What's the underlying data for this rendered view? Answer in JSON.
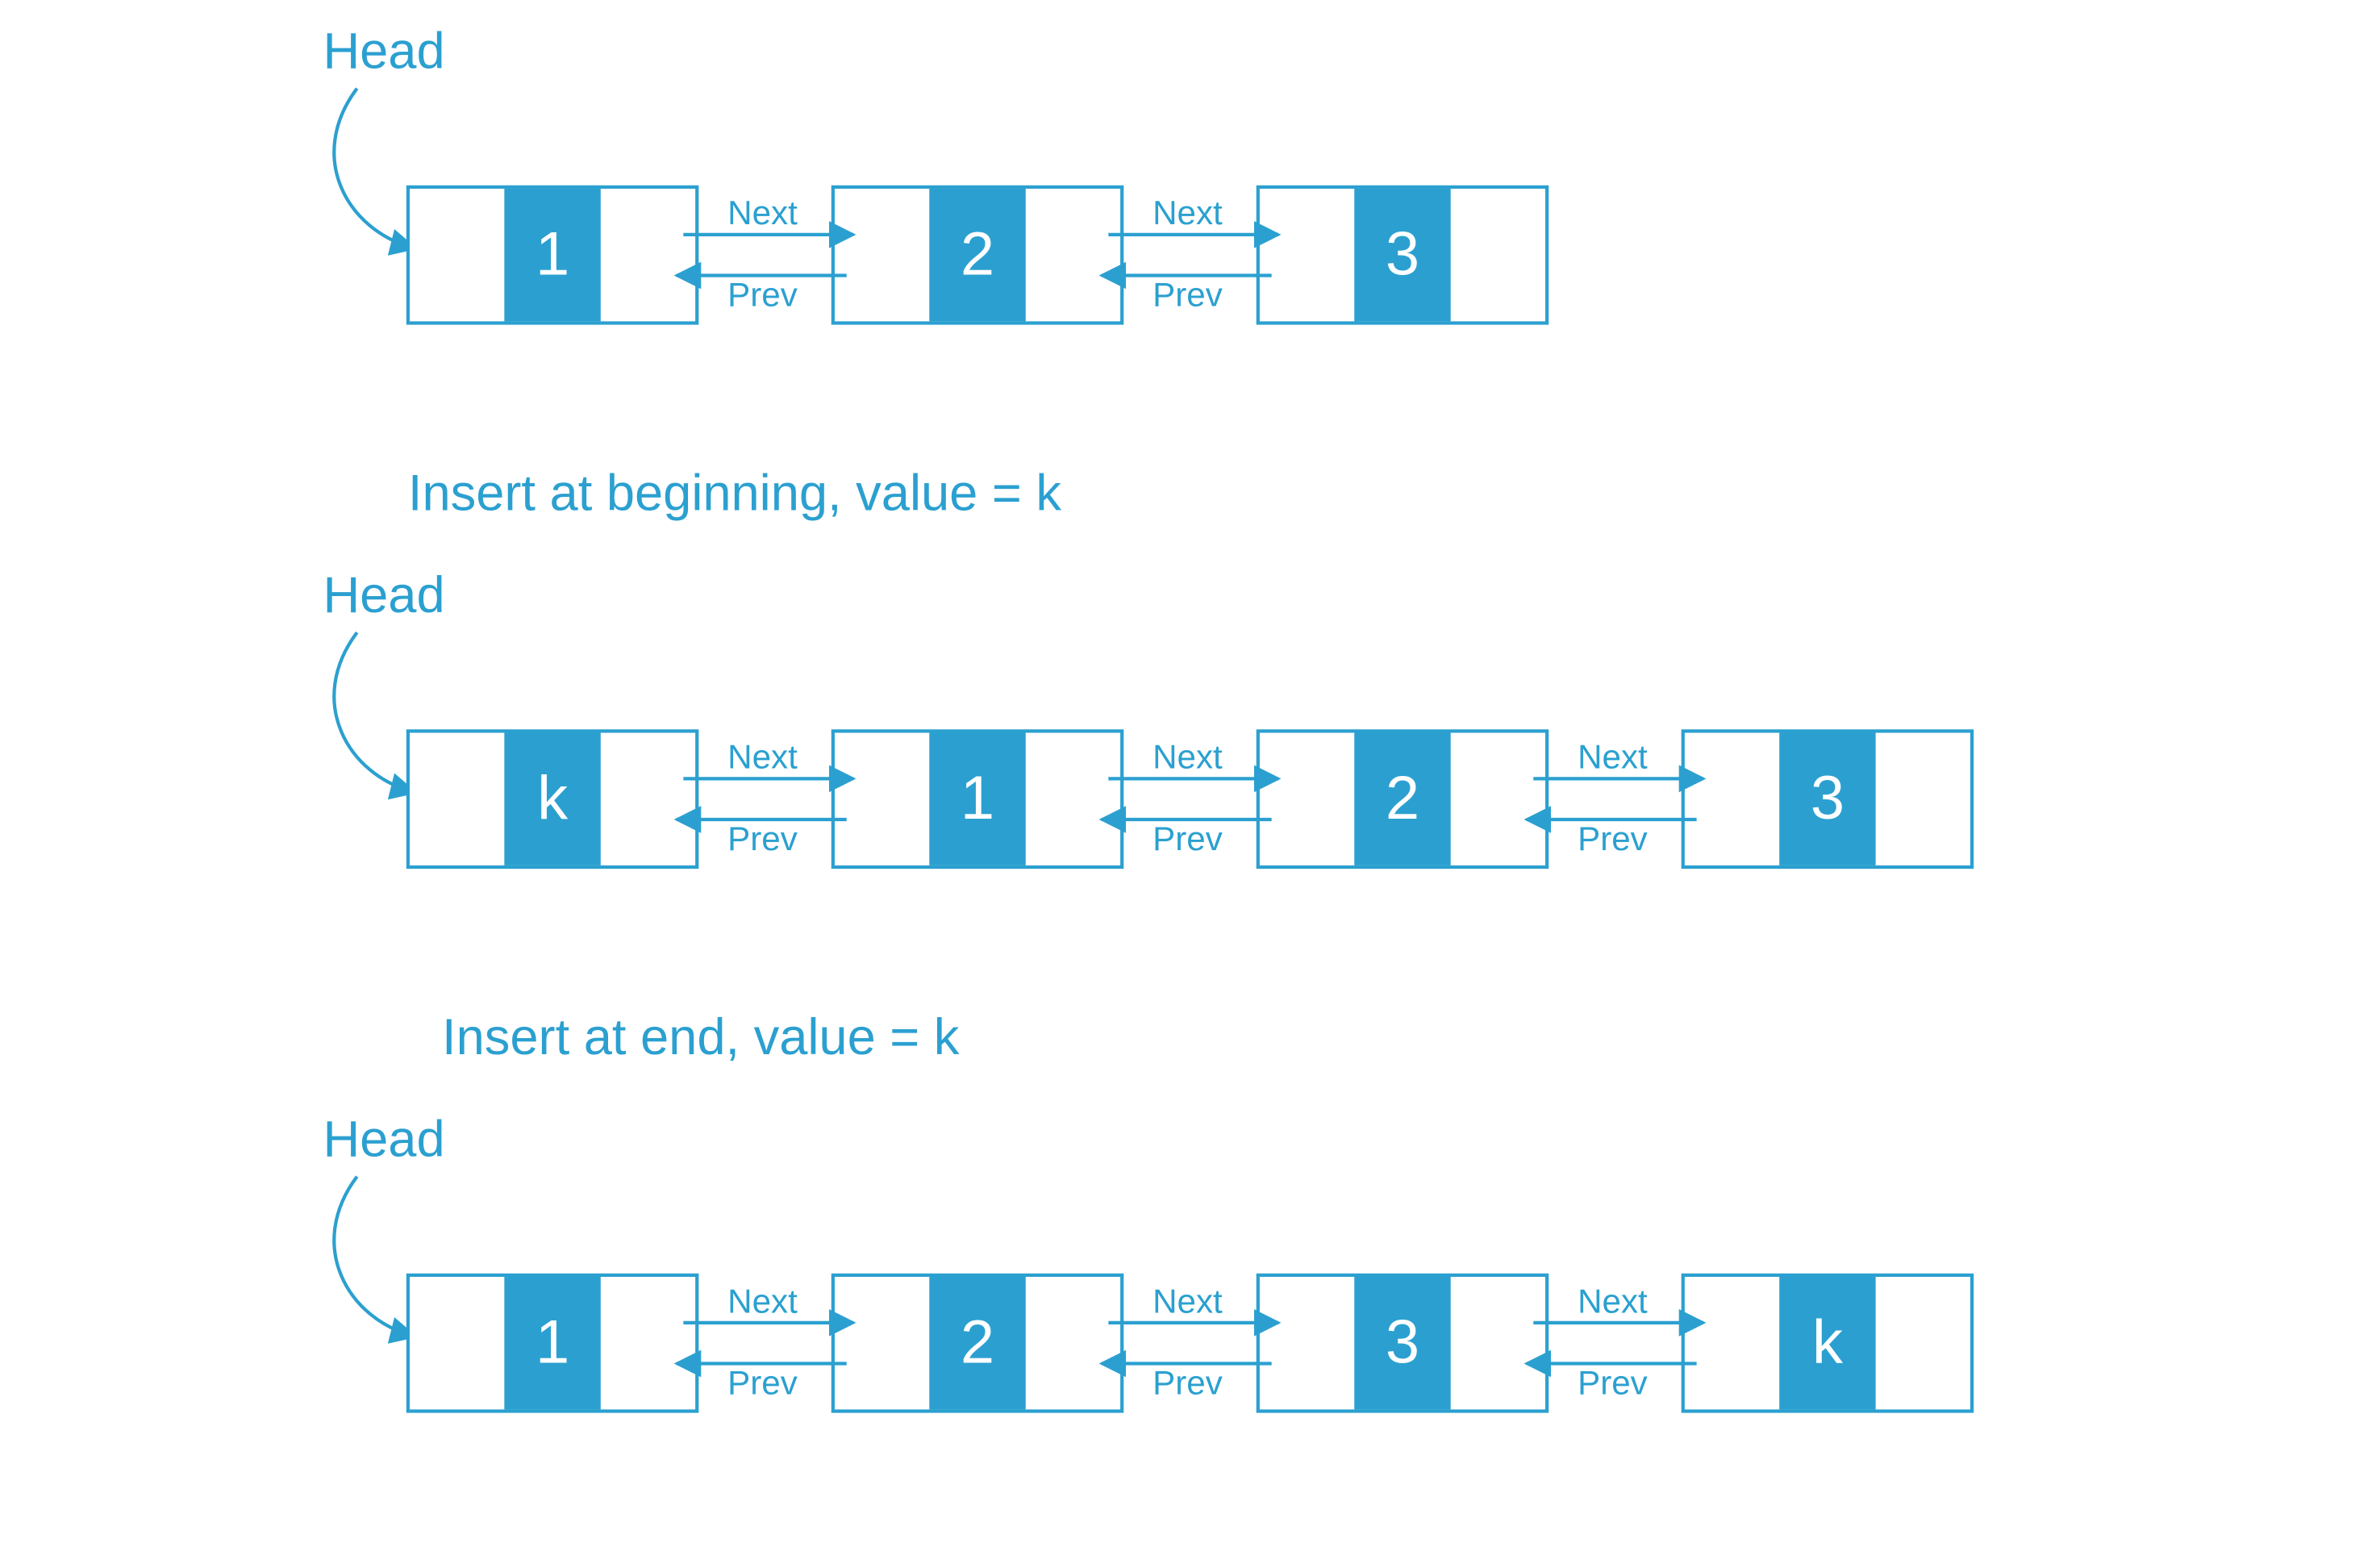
{
  "colors": {
    "accent": "#2ba0d0",
    "bg": "#ffffff"
  },
  "labels": {
    "head": "Head",
    "next": "Next",
    "prev": "Prev"
  },
  "captions": {
    "insert_begin": "Insert at beginning, value = k",
    "insert_end": "Insert at end, value = k"
  },
  "lists": {
    "row1": [
      "1",
      "2",
      "3"
    ],
    "row2": [
      "k",
      "1",
      "2",
      "3"
    ],
    "row3": [
      "1",
      "2",
      "3",
      "k"
    ]
  }
}
